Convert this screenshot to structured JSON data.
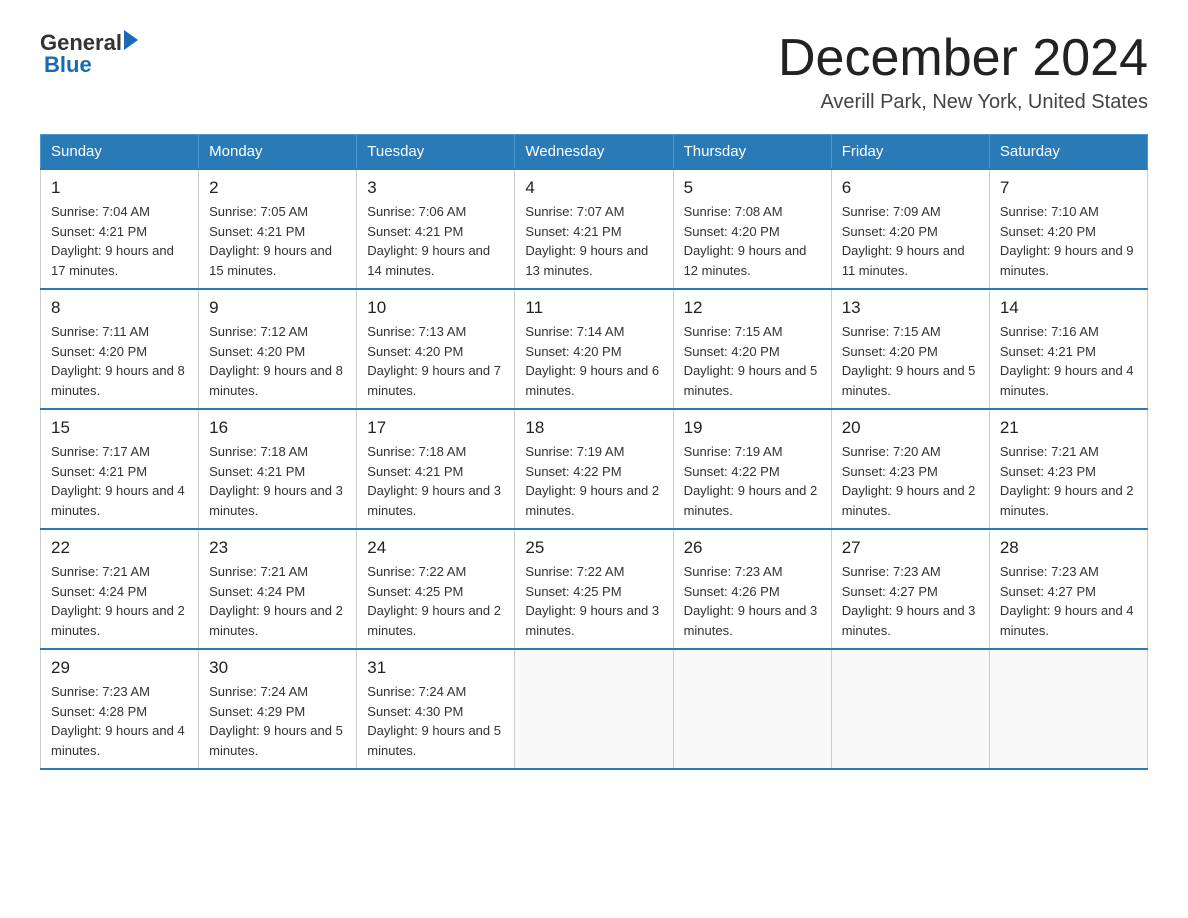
{
  "header": {
    "logo": {
      "general": "General",
      "blue": "Blue"
    },
    "title": "December 2024",
    "location": "Averill Park, New York, United States"
  },
  "days_of_week": [
    "Sunday",
    "Monday",
    "Tuesday",
    "Wednesday",
    "Thursday",
    "Friday",
    "Saturday"
  ],
  "weeks": [
    [
      {
        "day": "1",
        "sunrise": "7:04 AM",
        "sunset": "4:21 PM",
        "daylight": "9 hours and 17 minutes."
      },
      {
        "day": "2",
        "sunrise": "7:05 AM",
        "sunset": "4:21 PM",
        "daylight": "9 hours and 15 minutes."
      },
      {
        "day": "3",
        "sunrise": "7:06 AM",
        "sunset": "4:21 PM",
        "daylight": "9 hours and 14 minutes."
      },
      {
        "day": "4",
        "sunrise": "7:07 AM",
        "sunset": "4:21 PM",
        "daylight": "9 hours and 13 minutes."
      },
      {
        "day": "5",
        "sunrise": "7:08 AM",
        "sunset": "4:20 PM",
        "daylight": "9 hours and 12 minutes."
      },
      {
        "day": "6",
        "sunrise": "7:09 AM",
        "sunset": "4:20 PM",
        "daylight": "9 hours and 11 minutes."
      },
      {
        "day": "7",
        "sunrise": "7:10 AM",
        "sunset": "4:20 PM",
        "daylight": "9 hours and 9 minutes."
      }
    ],
    [
      {
        "day": "8",
        "sunrise": "7:11 AM",
        "sunset": "4:20 PM",
        "daylight": "9 hours and 8 minutes."
      },
      {
        "day": "9",
        "sunrise": "7:12 AM",
        "sunset": "4:20 PM",
        "daylight": "9 hours and 8 minutes."
      },
      {
        "day": "10",
        "sunrise": "7:13 AM",
        "sunset": "4:20 PM",
        "daylight": "9 hours and 7 minutes."
      },
      {
        "day": "11",
        "sunrise": "7:14 AM",
        "sunset": "4:20 PM",
        "daylight": "9 hours and 6 minutes."
      },
      {
        "day": "12",
        "sunrise": "7:15 AM",
        "sunset": "4:20 PM",
        "daylight": "9 hours and 5 minutes."
      },
      {
        "day": "13",
        "sunrise": "7:15 AM",
        "sunset": "4:20 PM",
        "daylight": "9 hours and 5 minutes."
      },
      {
        "day": "14",
        "sunrise": "7:16 AM",
        "sunset": "4:21 PM",
        "daylight": "9 hours and 4 minutes."
      }
    ],
    [
      {
        "day": "15",
        "sunrise": "7:17 AM",
        "sunset": "4:21 PM",
        "daylight": "9 hours and 4 minutes."
      },
      {
        "day": "16",
        "sunrise": "7:18 AM",
        "sunset": "4:21 PM",
        "daylight": "9 hours and 3 minutes."
      },
      {
        "day": "17",
        "sunrise": "7:18 AM",
        "sunset": "4:21 PM",
        "daylight": "9 hours and 3 minutes."
      },
      {
        "day": "18",
        "sunrise": "7:19 AM",
        "sunset": "4:22 PM",
        "daylight": "9 hours and 2 minutes."
      },
      {
        "day": "19",
        "sunrise": "7:19 AM",
        "sunset": "4:22 PM",
        "daylight": "9 hours and 2 minutes."
      },
      {
        "day": "20",
        "sunrise": "7:20 AM",
        "sunset": "4:23 PM",
        "daylight": "9 hours and 2 minutes."
      },
      {
        "day": "21",
        "sunrise": "7:21 AM",
        "sunset": "4:23 PM",
        "daylight": "9 hours and 2 minutes."
      }
    ],
    [
      {
        "day": "22",
        "sunrise": "7:21 AM",
        "sunset": "4:24 PM",
        "daylight": "9 hours and 2 minutes."
      },
      {
        "day": "23",
        "sunrise": "7:21 AM",
        "sunset": "4:24 PM",
        "daylight": "9 hours and 2 minutes."
      },
      {
        "day": "24",
        "sunrise": "7:22 AM",
        "sunset": "4:25 PM",
        "daylight": "9 hours and 2 minutes."
      },
      {
        "day": "25",
        "sunrise": "7:22 AM",
        "sunset": "4:25 PM",
        "daylight": "9 hours and 3 minutes."
      },
      {
        "day": "26",
        "sunrise": "7:23 AM",
        "sunset": "4:26 PM",
        "daylight": "9 hours and 3 minutes."
      },
      {
        "day": "27",
        "sunrise": "7:23 AM",
        "sunset": "4:27 PM",
        "daylight": "9 hours and 3 minutes."
      },
      {
        "day": "28",
        "sunrise": "7:23 AM",
        "sunset": "4:27 PM",
        "daylight": "9 hours and 4 minutes."
      }
    ],
    [
      {
        "day": "29",
        "sunrise": "7:23 AM",
        "sunset": "4:28 PM",
        "daylight": "9 hours and 4 minutes."
      },
      {
        "day": "30",
        "sunrise": "7:24 AM",
        "sunset": "4:29 PM",
        "daylight": "9 hours and 5 minutes."
      },
      {
        "day": "31",
        "sunrise": "7:24 AM",
        "sunset": "4:30 PM",
        "daylight": "9 hours and 5 minutes."
      },
      null,
      null,
      null,
      null
    ]
  ]
}
